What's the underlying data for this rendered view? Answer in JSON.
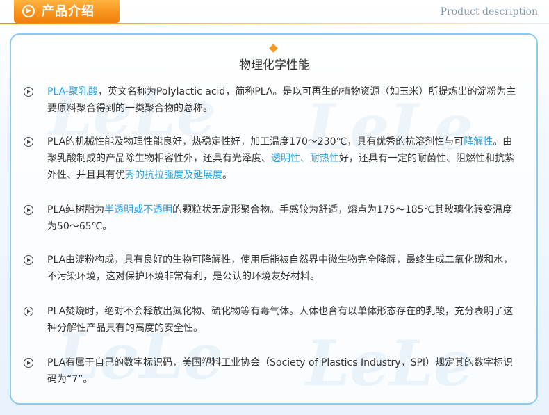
{
  "header": {
    "tab_icon_glyph": "▶",
    "title": "产品介绍",
    "subtitle": "Product description"
  },
  "watermark_text": "LeLe",
  "section": {
    "title": "物理化学性能"
  },
  "items": [
    {
      "segments": [
        {
          "text": "PLA-聚乳酸",
          "hl": true
        },
        {
          "text": "，英文名称为Polylactic acid，简称PLA。是以可再生的植物资源（如玉米）所提炼出的淀粉为主要原料聚合得到的一类聚合物的总称。",
          "hl": false
        }
      ]
    },
    {
      "segments": [
        {
          "text": "PLA的机械性能及物理性能良好，热稳定性好，加工温度170～230℃，具有优秀的抗溶剂性与可",
          "hl": false
        },
        {
          "text": "降解性",
          "hl": true
        },
        {
          "text": "。由聚乳酸制成的产品除生物相容性外，还具有光泽度、",
          "hl": false
        },
        {
          "text": "透明性、耐热性",
          "hl": true
        },
        {
          "text": "好，还具有一定的耐菌性、阻燃性和抗紫外性、并且具有优",
          "hl": false
        },
        {
          "text": "秀的抗拉强度及延展度",
          "hl": true
        },
        {
          "text": "。",
          "hl": false
        }
      ]
    },
    {
      "segments": [
        {
          "text": "PLA纯树脂为",
          "hl": false
        },
        {
          "text": "半透明或不透明",
          "hl": true
        },
        {
          "text": "的颗粒状无定形聚合物。手感较为舒适，熔点为175～185℃其玻璃化转变温度为50～65℃。",
          "hl": false
        }
      ]
    },
    {
      "segments": [
        {
          "text": "PLA由淀粉构成，具有良好的生物可降解性，使用后能被自然界中微生物完全降解，最终生成二氧化碳和水，不污染环境，这对保护环境非常有利，是公认的环境友好材料。",
          "hl": false
        }
      ]
    },
    {
      "segments": [
        {
          "text": "PLA焚烧时，绝对不会释放出氮化物、硫化物等有毒气体。人体也含有以单体形态存在的乳酸，充分表明了这种分解性产品具有的高度的安全性。",
          "hl": false
        }
      ]
    },
    {
      "segments": [
        {
          "text": "PLA有属于自己的数字标识码，美国塑料工业协会（Society of Plastics Industry，SPI）规定其的数字标识码为“7”。",
          "hl": false
        }
      ]
    }
  ]
}
